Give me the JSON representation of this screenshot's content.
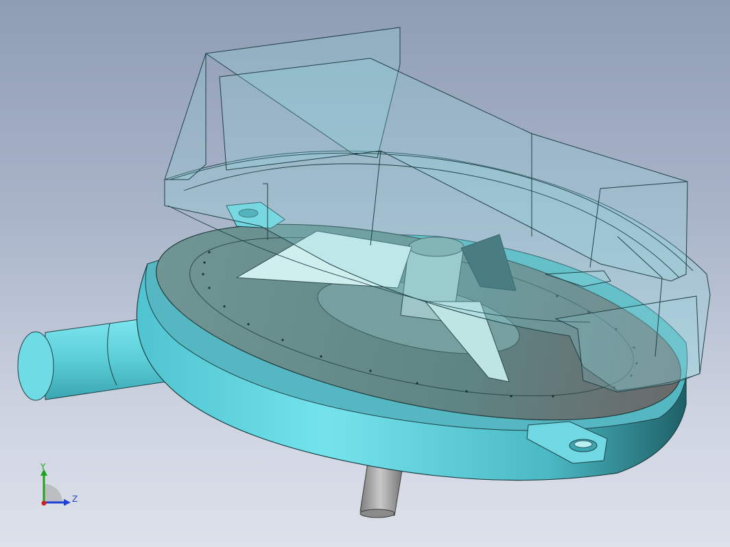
{
  "viewport": {
    "background_top": "#8f9db4",
    "background_bottom": "#dde1ea"
  },
  "model": {
    "body_color": "#6fd8e2",
    "glass_color": "#8fd6e0",
    "platter_color": "#5f8585",
    "blade_color": "#cfeeee",
    "shaft_color": "#a7a7a7"
  },
  "axis_triad": {
    "y_label": "Y",
    "z_label": "Z",
    "y_color": "#1ea31e",
    "z_color": "#1f3fd6",
    "x_color": "#d11f1f"
  }
}
